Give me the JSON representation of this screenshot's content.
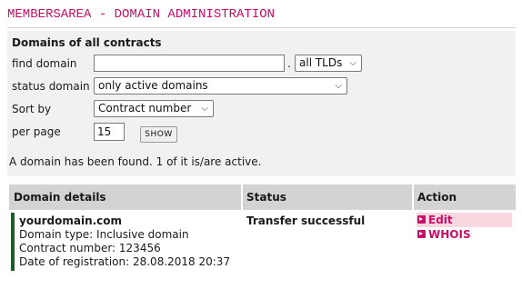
{
  "header": {
    "title": "MEMBERSAREA - DOMAIN ADMINISTRATION"
  },
  "filters": {
    "section_title": "Domains of all contracts",
    "find_domain_label": "find domain",
    "find_domain_value": "",
    "tld_dot": ".",
    "tld_select": "all TLDs",
    "status_label": "status domain",
    "status_select": "only active domains",
    "sort_label": "Sort by",
    "sort_select": "Contract number",
    "per_page_label": "per page",
    "per_page_value": "15",
    "show_button": "SHOW"
  },
  "result_message": "A domain has been found. 1 of it is/are active.",
  "table": {
    "headers": [
      "Domain details",
      "Status",
      "Action"
    ],
    "rows": [
      {
        "domain": "yourdomain.com",
        "type": "Domain type: Inclusive domain",
        "contract": "Contract number: 123456",
        "registered": "Date of registration: 28.08.2018 20:37",
        "status": "Transfer successful",
        "actions": [
          "Edit",
          "WHOIS"
        ]
      }
    ]
  },
  "colors": {
    "brand": "#cc0c6a",
    "panel": "#f1f1f1",
    "header_bg": "#d3d3d3",
    "row_marker": "#1d5d2a"
  }
}
